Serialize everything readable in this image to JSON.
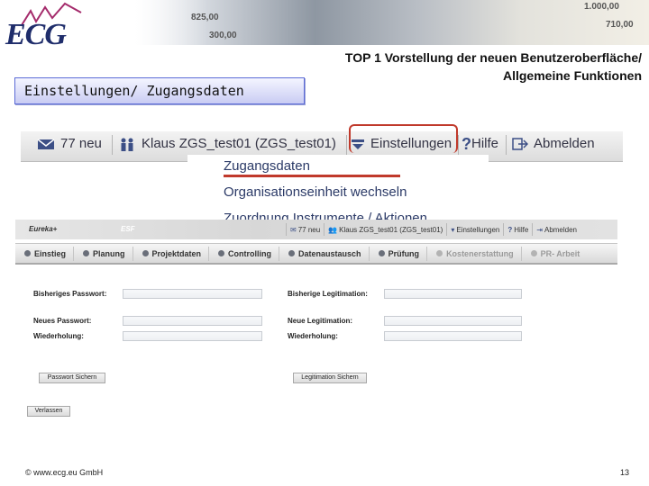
{
  "banner": {
    "numbers": [
      "1.000,00",
      "825,00",
      "710,00",
      "300,00"
    ]
  },
  "logo": {
    "text": "ECG"
  },
  "page_title": {
    "line1": "TOP 1 Vorstellung der neuen Benutzeroberfläche/",
    "line2": "Allgemeine Funktionen"
  },
  "section_label": "Einstellungen/ Zugangsdaten",
  "zoom_nav": {
    "items": [
      {
        "icon": "mail-icon",
        "label": "77 neu"
      },
      {
        "icon": "users-icon",
        "label": "Klaus ZGS_test01 (ZGS_test01)"
      },
      {
        "icon": "settings-icon",
        "label": "Einstellungen"
      },
      {
        "icon": "help-icon",
        "label": "Hilfe",
        "glyph": "?"
      },
      {
        "icon": "logout-icon",
        "label": "Abmelden"
      }
    ],
    "dropdown": [
      "Zugangsdaten",
      "Organisationseinheit wechseln",
      "Zuordnung Instrumente / Aktionen"
    ]
  },
  "app": {
    "brand": "Eureka+",
    "brand2": "ESF",
    "top_nav": [
      "77 neu",
      "Klaus ZGS_test01 (ZGS_test01)",
      "Einstellungen",
      "Hilfe",
      "Abmelden"
    ],
    "menu": [
      {
        "label": "Einstieg",
        "enabled": true
      },
      {
        "label": "Planung",
        "enabled": true
      },
      {
        "label": "Projektdaten",
        "enabled": true
      },
      {
        "label": "Controlling",
        "enabled": true
      },
      {
        "label": "Datenaustausch",
        "enabled": true
      },
      {
        "label": "Prüfung",
        "enabled": true
      },
      {
        "label": "Kostenerstattung",
        "enabled": false
      },
      {
        "label": "PR- Arbeit",
        "enabled": false
      }
    ],
    "form": {
      "old_password": "Bisheriges Passwort:",
      "new_password": "Neues Passwort:",
      "repeat_left": "Wiederholung:",
      "old_legit": "Bisherige Legitimation:",
      "new_legit": "Neue Legitimation:",
      "repeat_right": "Wiederholung:",
      "save_password": "Passwort Sichern",
      "save_legit": "Legitimation Sichern",
      "leave": "Verlassen"
    }
  },
  "footer": {
    "copyright": "© www.ecg.eu GmbH",
    "page": "13"
  },
  "colors": {
    "accent_red": "#c0392b",
    "logo_blue": "#1f2d6b",
    "label_border": "#5c6bd6"
  }
}
